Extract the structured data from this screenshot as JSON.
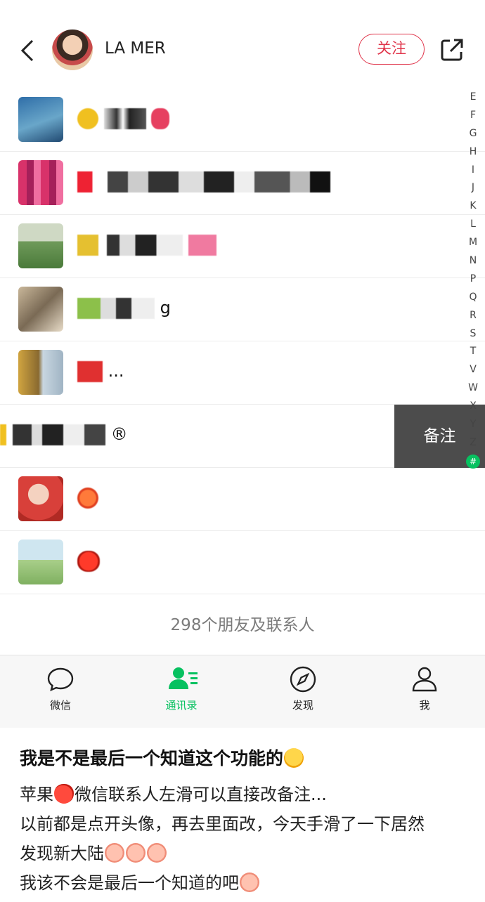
{
  "header": {
    "author": "LA MER",
    "follow_label": "关注"
  },
  "contacts": [
    {
      "name_visible": "",
      "avatar": "blue-phone-wallpaper"
    },
    {
      "name_visible": "",
      "avatar": "pink-mosaic"
    },
    {
      "name_visible": "",
      "avatar": "girl-in-field"
    },
    {
      "name_visible": "g",
      "avatar": "cat-photo"
    },
    {
      "name_visible": "...",
      "avatar": "yellow-flowers"
    },
    {
      "name_visible": "®",
      "avatar": ""
    },
    {
      "name_visible": "",
      "avatar": "red-portrait"
    },
    {
      "name_visible": "",
      "avatar": "green-landscape"
    }
  ],
  "swipe_action_label": "备注",
  "index_letters": [
    "E",
    "F",
    "G",
    "H",
    "I",
    "J",
    "K",
    "L",
    "M",
    "N",
    "P",
    "Q",
    "R",
    "S",
    "T",
    "V",
    "W",
    "X",
    "Y",
    "Z"
  ],
  "index_hash": "#",
  "contact_count": "298个朋友及联系人",
  "tabs": [
    {
      "label": "微信",
      "icon": "chat-bubble-icon",
      "active": false
    },
    {
      "label": "通讯录",
      "icon": "contacts-icon",
      "active": true
    },
    {
      "label": "发现",
      "icon": "compass-icon",
      "active": false
    },
    {
      "label": "我",
      "icon": "person-icon",
      "active": false
    }
  ],
  "post": {
    "title": "我是不是最后一个知道这个功能的",
    "lines": [
      {
        "before": "苹果",
        "after": "微信联系人左滑可以直接改备注..."
      },
      {
        "text": "以前都是点开头像，再去里面改，今天手滑了一下居然"
      },
      {
        "text": "发现新大陆"
      },
      {
        "text": "我该不会是最后一个知道的吧"
      }
    ]
  },
  "colors": {
    "accent_green": "#07c160",
    "follow_red": "#e0344a",
    "swipe_gray": "#4c4c4c"
  }
}
